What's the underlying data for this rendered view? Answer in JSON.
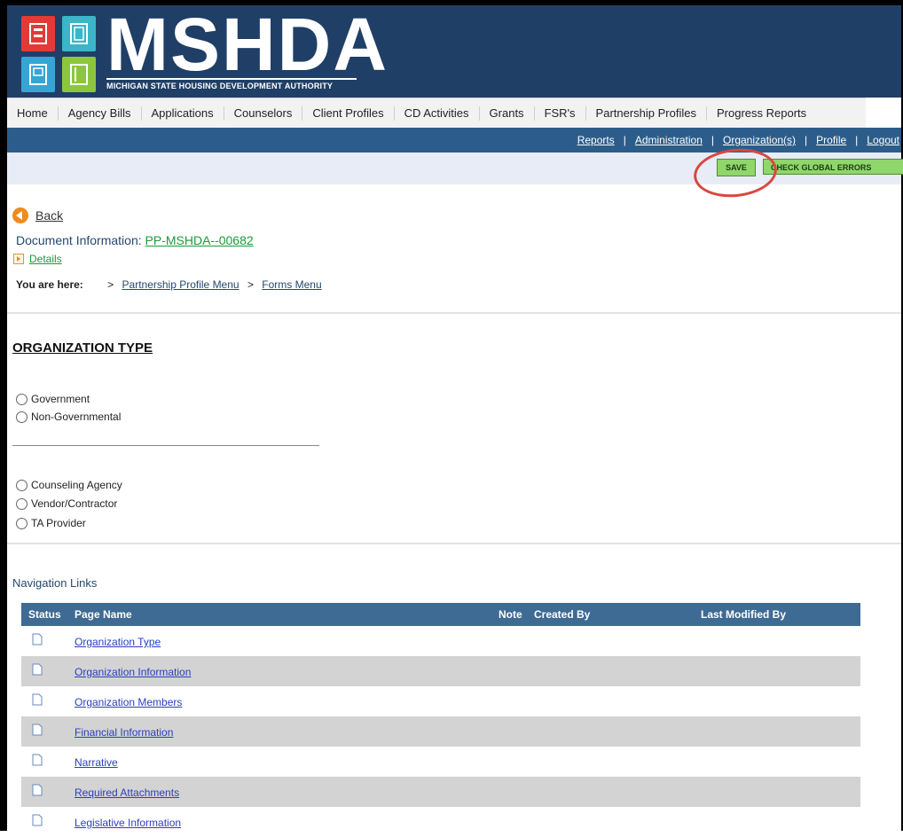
{
  "header": {
    "logo_text": "MSHDA",
    "logo_subtitle": "MICHIGAN STATE HOUSING DEVELOPMENT AUTHORITY"
  },
  "main_nav": [
    "Home",
    "Agency Bills",
    "Applications",
    "Counselors",
    "Client Profiles",
    "CD Activities",
    "Grants",
    "FSR's",
    "Partnership Profiles",
    "Progress Reports"
  ],
  "sub_nav": [
    "Reports",
    "Administration",
    "Organization(s)",
    "Profile",
    "Logout"
  ],
  "toolbar": {
    "save_label": "SAVE",
    "check_label": "CHECK GLOBAL ERRORS"
  },
  "back_label": "Back",
  "document": {
    "label": "Document Information:",
    "id": "PP-MSHDA--00682",
    "details_label": "Details"
  },
  "breadcrumb": {
    "label": "You are here:",
    "items": [
      "Partnership Profile Menu",
      "Forms Menu"
    ]
  },
  "section_title": "ORGANIZATION TYPE",
  "radio_group_1": [
    "Government",
    "Non-Governmental"
  ],
  "radio_group_2": [
    "Counseling Agency",
    "Vendor/Contractor",
    "TA Provider"
  ],
  "nav_links": {
    "title": "Navigation Links",
    "columns": [
      "Status",
      "Page Name",
      "Note",
      "Created By",
      "Last Modified By"
    ],
    "rows": [
      "Organization Type",
      "Organization Information",
      "Organization Members",
      "Financial Information",
      "Narrative",
      "Required Attachments",
      "Legislative Information"
    ]
  },
  "colors": {
    "header_bg": "#203f66",
    "subnav_bg": "#2c5d8a",
    "button_green": "#8fd66b",
    "highlight_circle": "#d9473f"
  }
}
